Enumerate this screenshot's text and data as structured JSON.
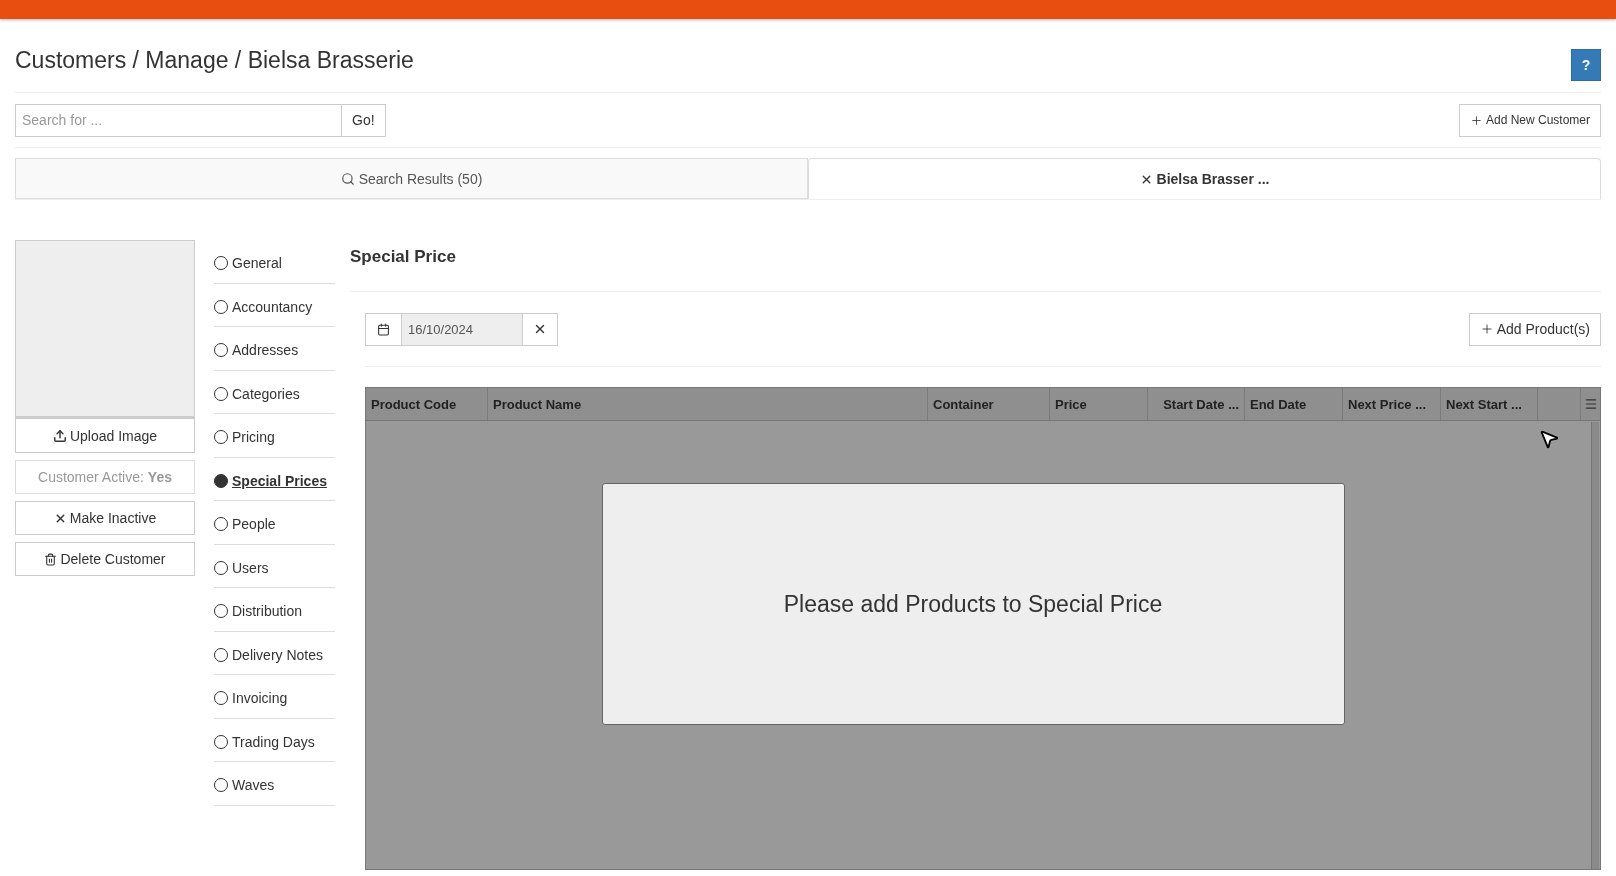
{
  "breadcrumb": "Customers / Manage / Bielsa Brasserie",
  "help_button": "?",
  "search": {
    "placeholder": "Search for ...",
    "go": "Go!"
  },
  "add_customer": "Add New Customer",
  "tabs": [
    {
      "label": "Search Results (50)",
      "selected": false,
      "kind": "search"
    },
    {
      "label": "Bielsa Brasser ...",
      "selected": true,
      "kind": "close"
    }
  ],
  "side_actions": {
    "upload": "Upload Image",
    "active_label": "Customer Active:",
    "active_value": "Yes",
    "make_inactive": "Make Inactive",
    "delete": "Delete Customer"
  },
  "nav": [
    {
      "label": "General",
      "selected": false
    },
    {
      "label": "Accountancy",
      "selected": false
    },
    {
      "label": "Addresses",
      "selected": false
    },
    {
      "label": "Categories",
      "selected": false
    },
    {
      "label": "Pricing",
      "selected": false
    },
    {
      "label": "Special Prices",
      "selected": true
    },
    {
      "label": "People",
      "selected": false
    },
    {
      "label": "Users",
      "selected": false
    },
    {
      "label": "Distribution",
      "selected": false
    },
    {
      "label": "Delivery Notes",
      "selected": false
    },
    {
      "label": "Invoicing",
      "selected": false
    },
    {
      "label": "Trading Days",
      "selected": false
    },
    {
      "label": "Waves",
      "selected": false
    }
  ],
  "section_title": "Special Price",
  "date_value": "16/10/2024",
  "add_product": "Add Product(s)",
  "table": {
    "columns": [
      "Product Code",
      "Product Name",
      "Container",
      "Price",
      "Start Date ...",
      "End Date",
      "Next Price ...",
      "Next Start ..."
    ],
    "empty_message": "Please add Products to Special Price"
  }
}
